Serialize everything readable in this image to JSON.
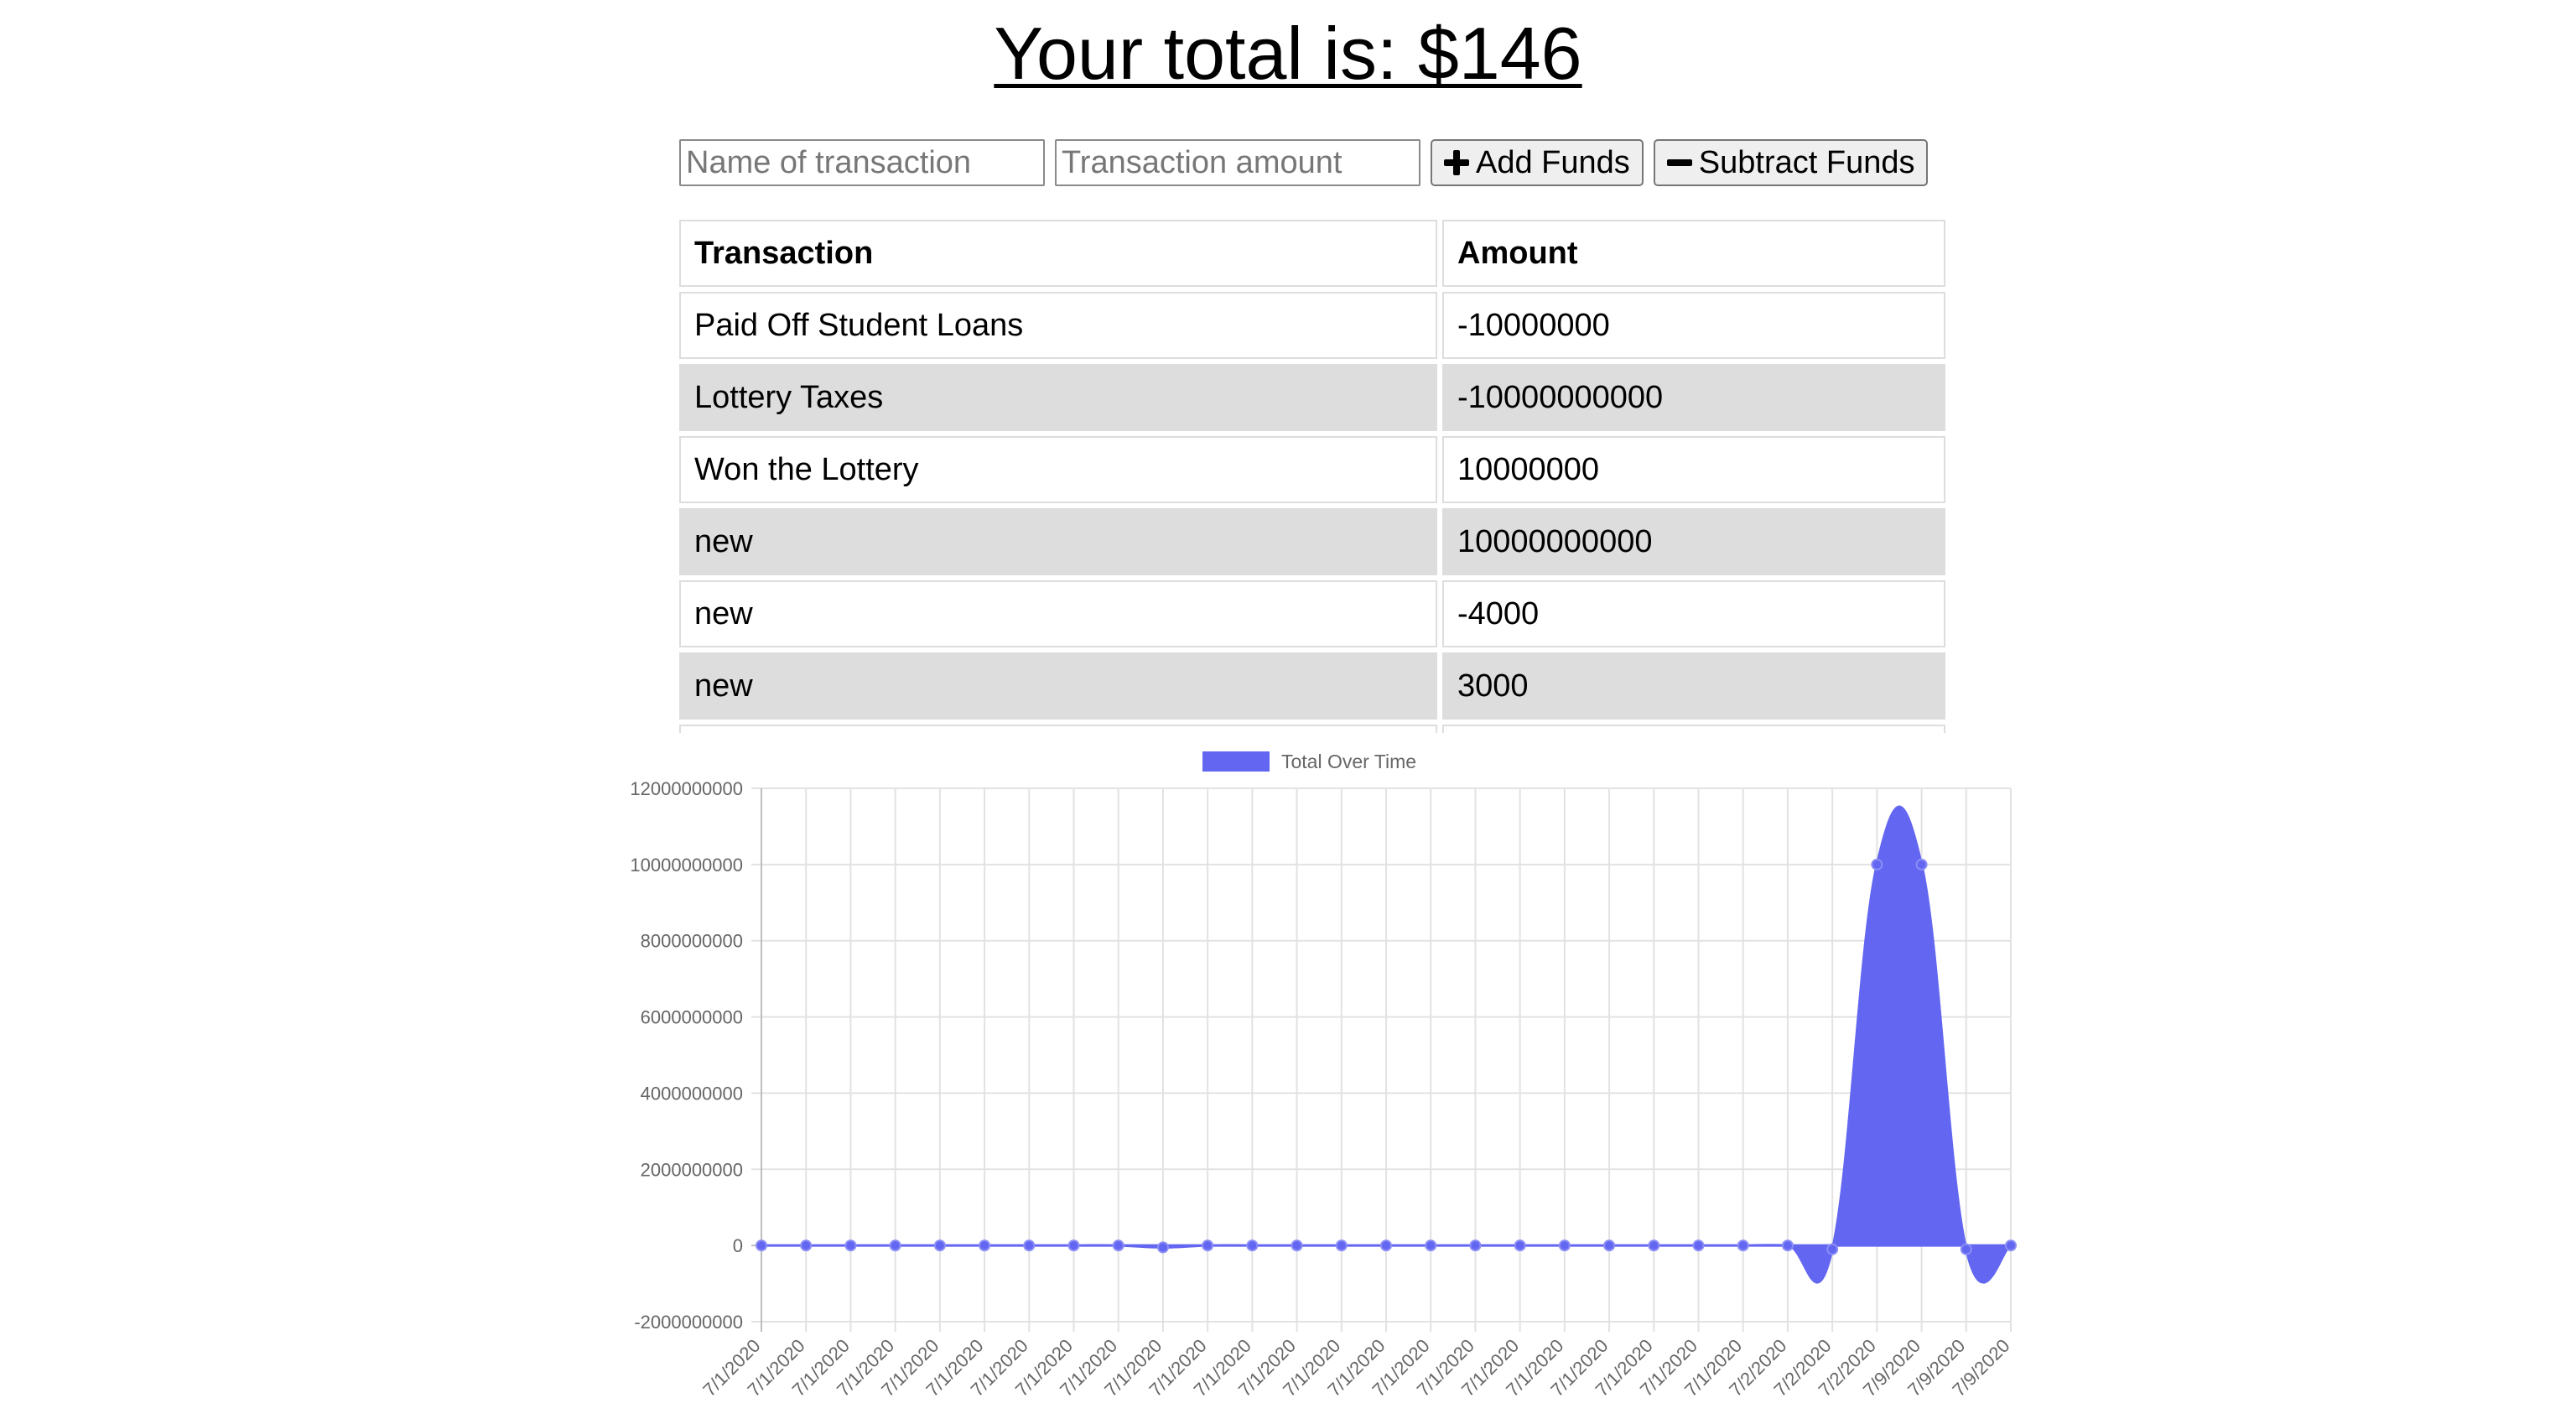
{
  "header": {
    "title": "Your total is: $146"
  },
  "form": {
    "name_placeholder": "Name of transaction",
    "amount_placeholder": "Transaction amount",
    "add_label": "Add Funds",
    "subtract_label": "Subtract Funds"
  },
  "table": {
    "headers": [
      "Transaction",
      "Amount"
    ],
    "rows": [
      [
        "Paid Off Student Loans",
        "-10000000"
      ],
      [
        "Lottery Taxes",
        "-10000000000"
      ],
      [
        "Won the Lottery",
        "10000000"
      ],
      [
        "new",
        "10000000000"
      ],
      [
        "new",
        "-4000"
      ],
      [
        "new",
        "3000"
      ],
      [
        "",
        ""
      ]
    ]
  },
  "chart_data": {
    "type": "area",
    "legend": "Total Over Time",
    "legend_position": "top",
    "grid": true,
    "ylim": [
      -2000000000,
      12000000000
    ],
    "yticks": [
      "12000000000",
      "10000000000",
      "8000000000",
      "6000000000",
      "4000000000",
      "2000000000",
      "0",
      "-2000000000"
    ],
    "x": [
      "7/1/2020",
      "7/1/2020",
      "7/1/2020",
      "7/1/2020",
      "7/1/2020",
      "7/1/2020",
      "7/1/2020",
      "7/1/2020",
      "7/1/2020",
      "7/1/2020",
      "7/1/2020",
      "7/1/2020",
      "7/1/2020",
      "7/1/2020",
      "7/1/2020",
      "7/1/2020",
      "7/1/2020",
      "7/1/2020",
      "7/1/2020",
      "7/1/2020",
      "7/1/2020",
      "7/1/2020",
      "7/1/2020",
      "7/2/2020",
      "7/2/2020",
      "7/2/2020",
      "7/9/2020",
      "7/9/2020",
      "7/9/2020"
    ],
    "values": [
      0,
      0,
      0,
      0,
      0,
      0,
      0,
      0,
      0,
      -50000000,
      0,
      0,
      0,
      0,
      0,
      0,
      0,
      0,
      0,
      0,
      0,
      0,
      0,
      0,
      -100000000,
      10000000000,
      10000000000,
      -100000000,
      0
    ],
    "colors": {
      "fill": "#6366f1",
      "stroke": "#6366f1",
      "grid": "#e2e2e2",
      "zero_line": "#bdbdbd"
    }
  }
}
